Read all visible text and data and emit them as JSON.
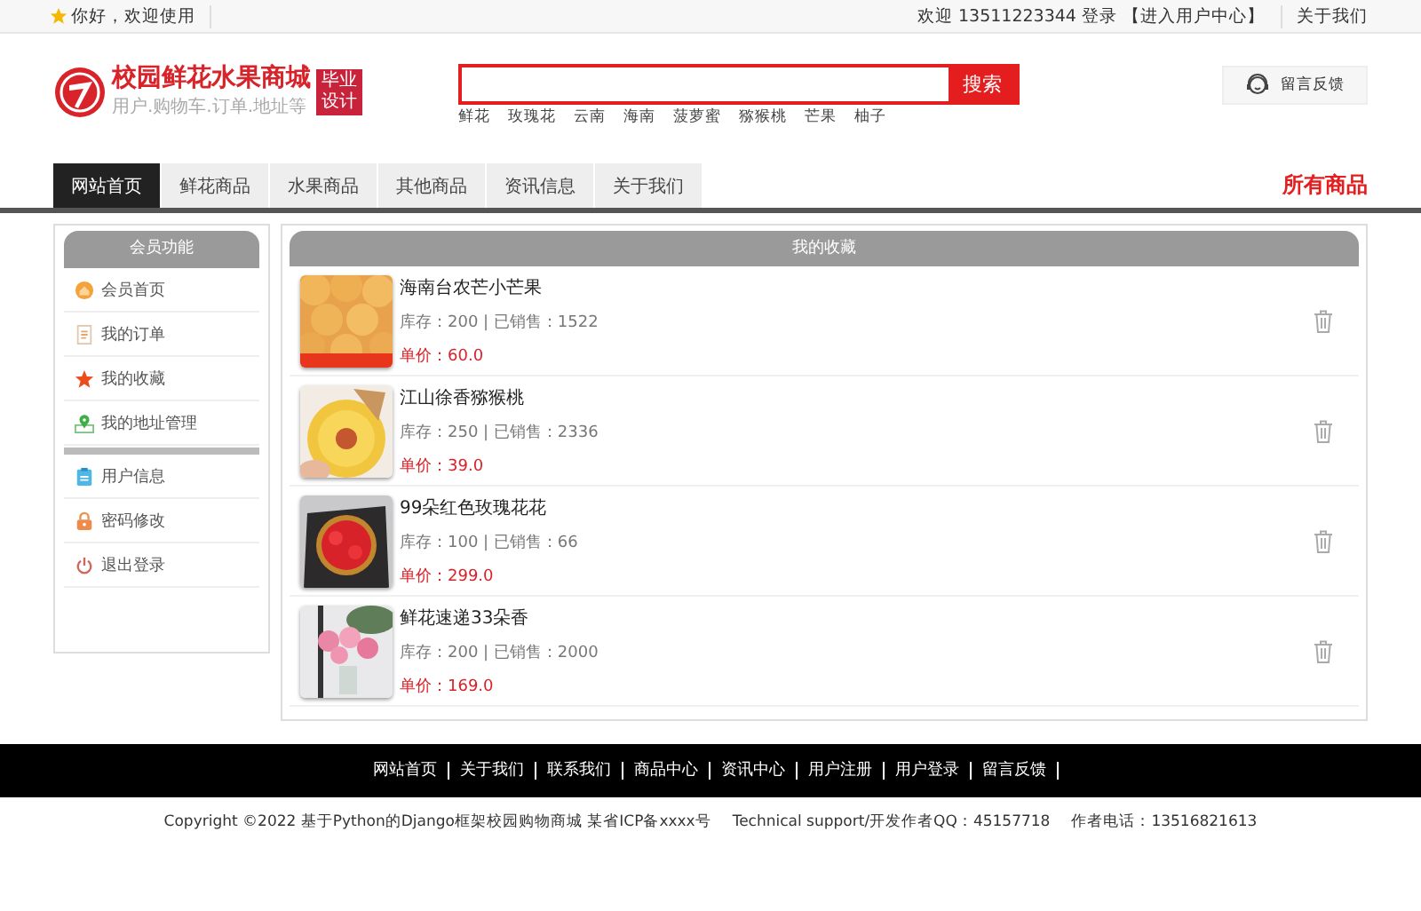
{
  "top_bar": {
    "greeting": "你好，欢迎使用",
    "welcome": "欢迎 13511223344 登录",
    "user_center_link": "【进入用户中心】",
    "about_link": "关于我们"
  },
  "header": {
    "site_title": "校园鲜花水果商城",
    "subtitle": "用户.购物车.订单.地址等",
    "badge_lines": [
      "毕业",
      "设计"
    ],
    "search": {
      "button": "搜索"
    },
    "hot_words": [
      "鲜花",
      "玫瑰花",
      "云南",
      "海南",
      "菠萝蜜",
      "猕猴桃",
      "芒果",
      "柚子"
    ],
    "feedback_button": "留言反馈"
  },
  "nav": {
    "tabs": [
      {
        "label": "网站首页",
        "selected": true
      },
      {
        "label": "鲜花商品",
        "selected": false
      },
      {
        "label": "水果商品",
        "selected": false
      },
      {
        "label": "其他商品",
        "selected": false
      },
      {
        "label": "资讯信息",
        "selected": false
      },
      {
        "label": "关于我们",
        "selected": false
      }
    ],
    "all_products": "所有商品"
  },
  "sidebar": {
    "title": "会员功能",
    "groups": [
      [
        {
          "label": "会员首页",
          "kind": "home"
        },
        {
          "label": "我的订单",
          "kind": "order"
        },
        {
          "label": "我的收藏",
          "kind": "star"
        },
        {
          "label": "我的地址管理",
          "kind": "pin"
        }
      ],
      [
        {
          "label": "用户信息",
          "kind": "info"
        },
        {
          "label": "密码修改",
          "kind": "lock"
        },
        {
          "label": "退出登录",
          "kind": "power"
        }
      ]
    ]
  },
  "favorites": {
    "title": "我的收藏",
    "items": [
      {
        "name": "海南台农芒小芒果",
        "stock": "库存：200 | 已销售：1522",
        "price": "单价：60.0"
      },
      {
        "name": "江山徐香猕猴桃",
        "stock": "库存：250 | 已销售：2336",
        "price": "单价：39.0"
      },
      {
        "name": "99朵红色玫瑰花花",
        "stock": "库存：100 | 已销售：66",
        "price": "单价：299.0"
      },
      {
        "name": "鲜花速递33朵香",
        "stock": "库存：200 | 已销售：2000",
        "price": "单价：169.0"
      }
    ]
  },
  "footer": {
    "links": [
      "网站首页",
      "关于我们",
      "联系我们",
      "商品中心",
      "资讯中心",
      "用户注册",
      "用户登录",
      "留言反馈"
    ],
    "copyright": "Copyright ©2022 基于Python的Django框架校园购物商城 某省ICP备xxxx号",
    "support": "Technical support/开发作者QQ：45157718",
    "phone": "作者电话：13516821613"
  }
}
